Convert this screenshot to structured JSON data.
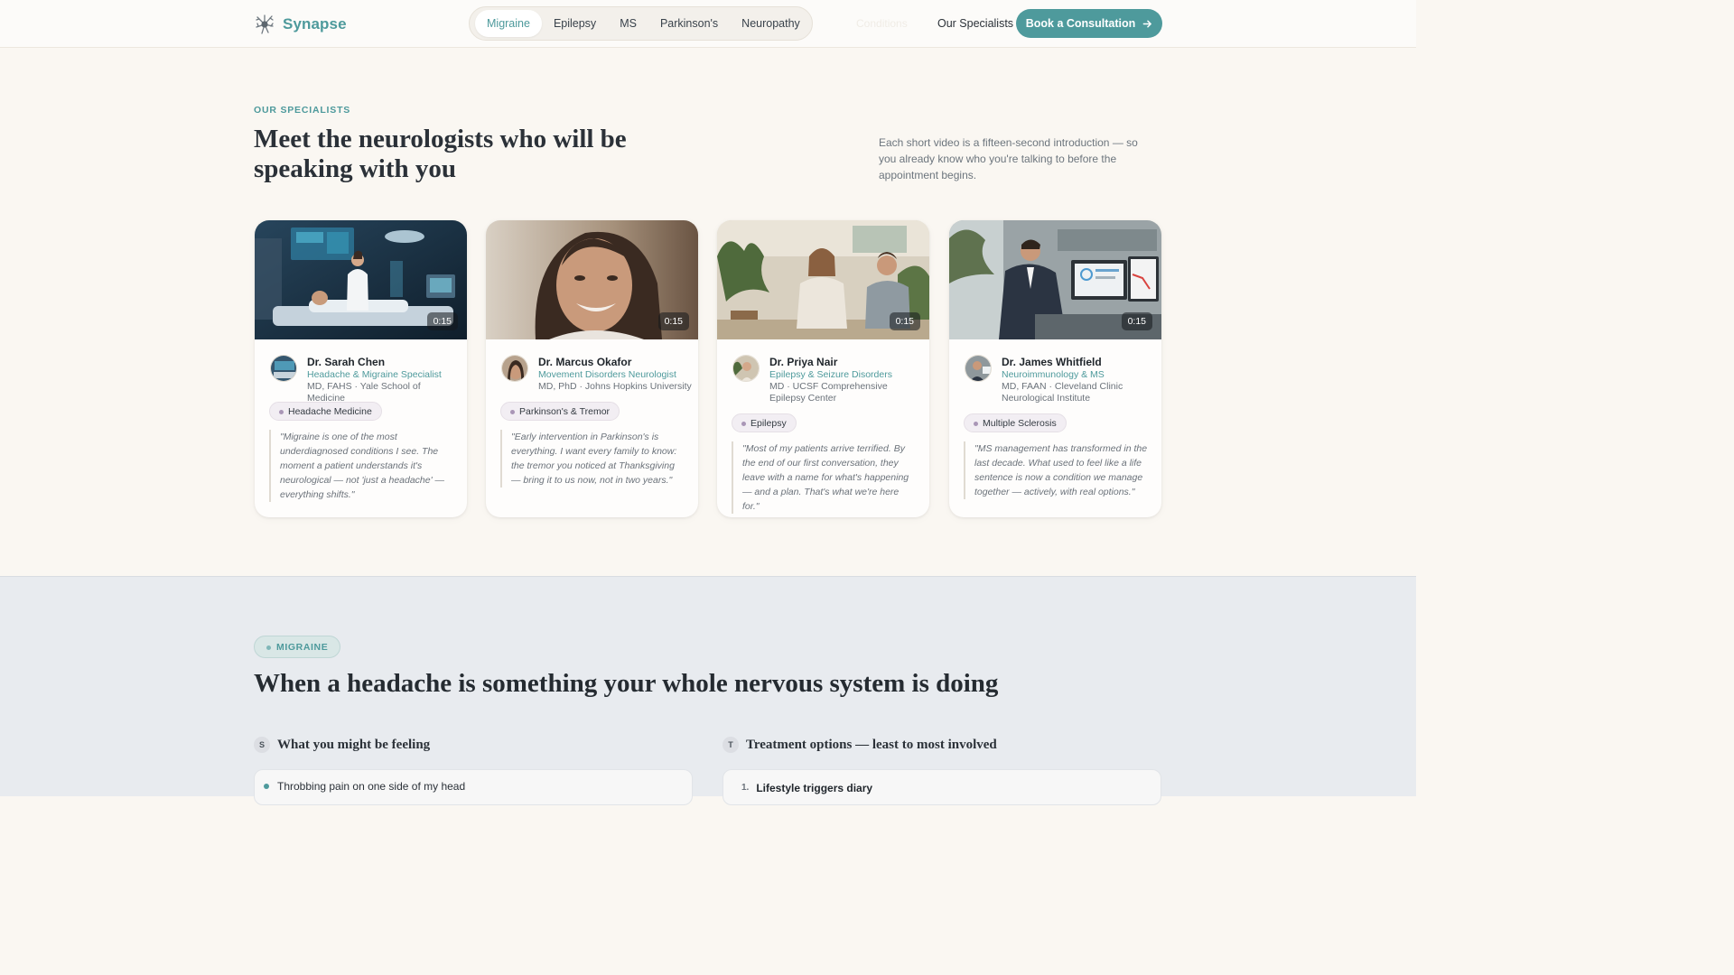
{
  "header": {
    "brand": "Synapse",
    "nav": [
      "Migraine",
      "Epilepsy",
      "MS",
      "Parkinson's",
      "Neuropathy"
    ],
    "active_nav": "Migraine",
    "ghost_link": "Conditions",
    "specialists_link": "Our Specialists",
    "cta_label": "Book a Consultation",
    "cta_icon": "arrow-right-icon"
  },
  "specialists": {
    "eyebrow": "OUR SPECIALISTS",
    "title": "Meet the neurologists who will be speaking with you",
    "intro": "Each short video is a fifteen-second introduction — so you already know who you're talking to before the appointment begins.",
    "cards": [
      {
        "duration": "0:15",
        "name": "Dr. Sarah Chen",
        "role": "Headache & Migraine Specialist",
        "credentials": "MD, FAHS · Yale School of Medicine",
        "tag": "Headache Medicine",
        "quote": "\"Migraine is one of the most underdiagnosed conditions I see. The moment a patient understands it's neurological — not 'just a headache' — everything shifts.\""
      },
      {
        "duration": "0:15",
        "name": "Dr. Marcus Okafor",
        "role": "Movement Disorders Neurologist",
        "credentials": "MD, PhD · Johns Hopkins University",
        "tag": "Parkinson's & Tremor",
        "quote": "\"Early intervention in Parkinson's is everything. I want every family to know: the tremor you noticed at Thanksgiving — bring it to us now, not in two years.\""
      },
      {
        "duration": "0:15",
        "name": "Dr. Priya Nair",
        "role": "Epilepsy & Seizure Disorders",
        "credentials": "MD · UCSF Comprehensive Epilepsy Center",
        "tag": "Epilepsy",
        "quote": "\"Most of my patients arrive terrified. By the end of our first conversation, they leave with a name for what's happening — and a plan. That's what we're here for.\""
      },
      {
        "duration": "0:15",
        "name": "Dr. James Whitfield",
        "role": "Neuroimmunology & MS",
        "credentials": "MD, FAAN · Cleveland Clinic Neurological Institute",
        "tag": "Multiple Sclerosis",
        "quote": "\"MS management has transformed in the last decade. What used to feel like a life sentence is now a condition we manage together — actively, with real options.\""
      }
    ]
  },
  "condition": {
    "badge": "MIGRAINE",
    "title": "When a headache is something your whole nervous system is doing",
    "symptoms_letter": "S",
    "symptoms_title": "What you might be feeling",
    "symptoms": [
      "Throbbing pain on one side of my head"
    ],
    "treatments_letter": "T",
    "treatments_title": "Treatment options — least to most involved",
    "treatments": [
      {
        "num": "1.",
        "label": "Lifestyle triggers diary"
      }
    ]
  },
  "colors": {
    "accent": "#4e9a9c",
    "page_bg": "#faf7f2",
    "lower_bg": "#e8ebef",
    "tag_dot": "#a996b6"
  }
}
